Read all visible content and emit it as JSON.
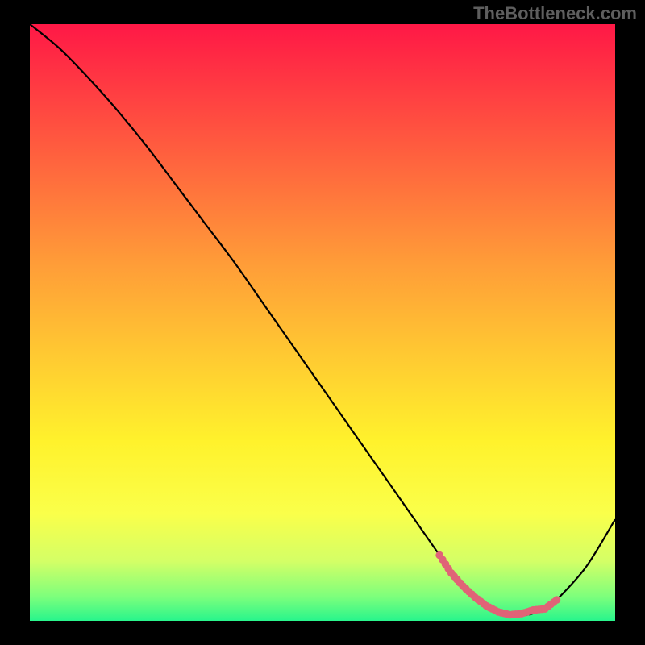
{
  "attribution": "TheBottleneck.com",
  "chart_data": {
    "type": "line",
    "title": "",
    "xlabel": "",
    "ylabel": "",
    "xlim": [
      0,
      100
    ],
    "ylim": [
      0,
      100
    ],
    "grid": false,
    "legend": false,
    "background": "rainbow-gradient",
    "series": [
      {
        "name": "curve",
        "color": "#000000",
        "x": [
          0,
          5,
          10,
          15,
          20,
          25,
          30,
          35,
          40,
          45,
          50,
          55,
          60,
          65,
          70,
          72,
          75,
          78,
          80,
          82,
          85,
          88,
          90,
          95,
          100
        ],
        "y": [
          100,
          96,
          91,
          85.5,
          79.5,
          73,
          66.5,
          60,
          53,
          46,
          39,
          32,
          25,
          18,
          11,
          8,
          5,
          2.5,
          1.5,
          1,
          1,
          2,
          3.5,
          9,
          17
        ]
      },
      {
        "name": "highlighted-band",
        "color": "#e06377",
        "style": "thick-dotted",
        "x": [
          70,
          72,
          74,
          76,
          78,
          80,
          82,
          84,
          86,
          88,
          90
        ],
        "y": [
          11,
          8,
          5.8,
          4,
          2.5,
          1.5,
          1,
          1.2,
          1.8,
          2,
          3.5
        ]
      }
    ],
    "gradient_stops": [
      {
        "offset": 0.0,
        "color": "#ff1846"
      },
      {
        "offset": 0.2,
        "color": "#ff5a3f"
      },
      {
        "offset": 0.4,
        "color": "#ff9c38"
      },
      {
        "offset": 0.55,
        "color": "#ffc832"
      },
      {
        "offset": 0.7,
        "color": "#fff22c"
      },
      {
        "offset": 0.82,
        "color": "#faff4a"
      },
      {
        "offset": 0.9,
        "color": "#d4ff66"
      },
      {
        "offset": 0.96,
        "color": "#7cff7c"
      },
      {
        "offset": 1.0,
        "color": "#28f58c"
      }
    ]
  }
}
